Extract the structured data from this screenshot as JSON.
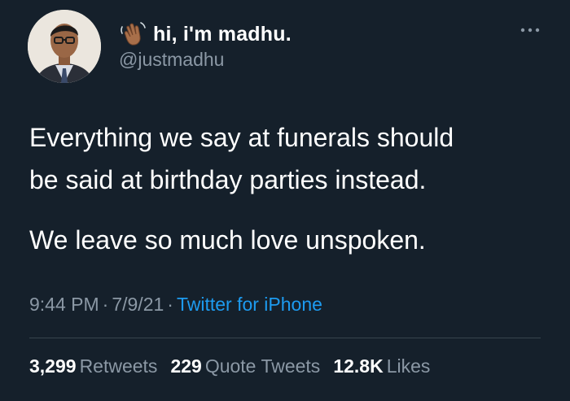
{
  "author": {
    "display_name": "hi, i'm madhu.",
    "handle": "@justmadhu",
    "avatar_icon": "profile-photo",
    "name_emoji": "waving-hand-icon"
  },
  "tweet": {
    "lines": [
      "Everything we say at funerals should",
      "be said at birthday parties instead.",
      "We leave so much love unspoken."
    ]
  },
  "meta": {
    "time": "9:44 PM",
    "separator": "·",
    "date": "7/9/21",
    "source": "Twitter for iPhone"
  },
  "stats": {
    "retweets_count": "3,299",
    "retweets_label": "Retweets",
    "quotes_count": "229",
    "quotes_label": "Quote Tweets",
    "likes_count": "12.8K",
    "likes_label": "Likes"
  },
  "colors": {
    "background": "#15202b",
    "primary_text": "#ffffff",
    "secondary_text": "#8b98a5",
    "link": "#1d9bf0",
    "divider": "#38444d"
  }
}
